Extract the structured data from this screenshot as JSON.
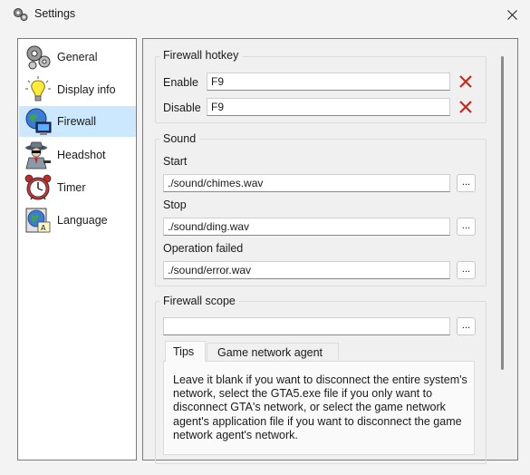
{
  "window": {
    "title": "Settings",
    "icon": "gears-icon"
  },
  "sidebar": {
    "items": [
      {
        "label": "General",
        "icon": "gears-icon",
        "active": false
      },
      {
        "label": "Display info",
        "icon": "lightbulb-icon",
        "active": false
      },
      {
        "label": "Firewall",
        "icon": "globe-computer-icon",
        "active": true
      },
      {
        "label": "Headshot",
        "icon": "spy-agent-icon",
        "active": false
      },
      {
        "label": "Timer",
        "icon": "alarm-clock-icon",
        "active": false
      },
      {
        "label": "Language",
        "icon": "language-globe-icon",
        "active": false
      }
    ]
  },
  "hotkey": {
    "title": "Firewall hotkey",
    "enable_label": "Enable",
    "enable_value": "F9",
    "disable_label": "Disable",
    "disable_value": "F9"
  },
  "sound": {
    "title": "Sound",
    "start_label": "Start",
    "start_value": "./sound/chimes.wav",
    "stop_label": "Stop",
    "stop_value": "./sound/ding.wav",
    "failed_label": "Operation failed",
    "failed_value": "./sound/error.wav",
    "browse_label": "..."
  },
  "scope": {
    "title": "Firewall scope",
    "value": "",
    "browse_label": "...",
    "tabs": [
      {
        "label": "Tips",
        "active": true
      },
      {
        "label": "Game network agent",
        "active": false
      }
    ],
    "tip_text": "Leave it blank if you want to disconnect the entire system's network, select the GTA5.exe file if you only want to disconnect GTA's network, or select the game network agent's application file if you want to disconnect the game network agent's network."
  },
  "colors": {
    "active_item_bg": "#cce8ff",
    "clear_x": "#c42b1c"
  }
}
